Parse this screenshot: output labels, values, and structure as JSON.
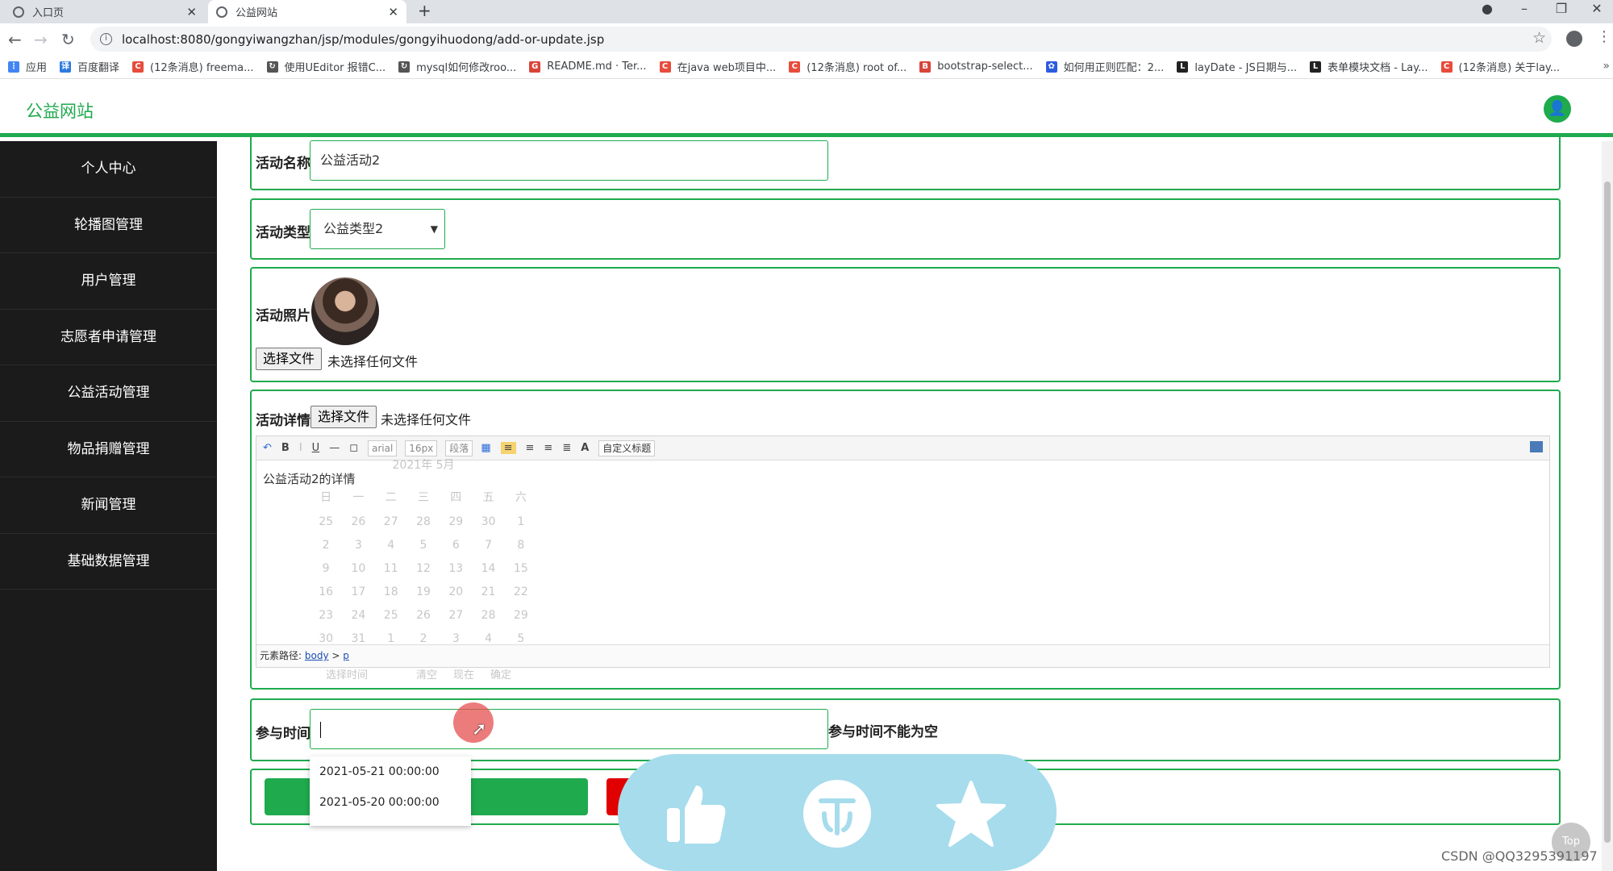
{
  "browser": {
    "tabs": [
      {
        "title": "入口页",
        "active": false
      },
      {
        "title": "公益网站",
        "active": true
      }
    ],
    "url": "localhost:8080/gongyiwangzhan/jsp/modules/gongyihuodong/add-or-update.jsp",
    "bookmarks": [
      {
        "label": "应用",
        "color": "#4285f4"
      },
      {
        "label": "百度翻译",
        "color": "#2d7ae0"
      },
      {
        "label": "(12条消息) freema...",
        "color": "#e74c3c"
      },
      {
        "label": "使用UEditor 报错C...",
        "color": "#555555"
      },
      {
        "label": "mysql如何修改roo...",
        "color": "#555555"
      },
      {
        "label": "README.md · Ter...",
        "color": "#d9443a"
      },
      {
        "label": "在java web项目中...",
        "color": "#e74c3c"
      },
      {
        "label": "(12条消息) root of...",
        "color": "#e74c3c"
      },
      {
        "label": "bootstrap-select...",
        "color": "#d9443a"
      },
      {
        "label": "如何用正则匹配：2...",
        "color": "#2d5be0"
      },
      {
        "label": "layDate - JS日期与...",
        "color": "#222222"
      },
      {
        "label": "表单模块文档 - Lay...",
        "color": "#222222"
      },
      {
        "label": "(12条消息) 关于lay...",
        "color": "#e74c3c"
      }
    ]
  },
  "header": {
    "title": "公益网站",
    "accent": "#1faa4e"
  },
  "sidebar": {
    "items": [
      {
        "label": "个人中心"
      },
      {
        "label": "轮播图管理"
      },
      {
        "label": "用户管理"
      },
      {
        "label": "志愿者申请管理"
      },
      {
        "label": "公益活动管理"
      },
      {
        "label": "物品捐赠管理"
      },
      {
        "label": "新闻管理"
      },
      {
        "label": "基础数据管理"
      }
    ]
  },
  "form": {
    "name_label": "活动名称",
    "name_value": "公益活动2",
    "type_label": "活动类型",
    "type_value": "公益类型2",
    "photo_label": "活动照片",
    "file_button": "选择文件",
    "no_file": "未选择任何文件",
    "detail_label": "活动详情",
    "time_label": "参与时间",
    "time_error": "参与时间不能为空"
  },
  "editor": {
    "font": "arial",
    "size": "16px",
    "paragraph": "段落",
    "custom_title": "自定义标题",
    "content": "公益活动2的详情",
    "path_label": "元素路径:",
    "path_body": "body",
    "path_sep": ">",
    "path_p": "p"
  },
  "calendar": {
    "header": "2021年  5月",
    "weekdays": [
      "日",
      "一",
      "二",
      "三",
      "四",
      "五",
      "六"
    ],
    "days": [
      "25",
      "26",
      "27",
      "28",
      "29",
      "30",
      "1",
      "2",
      "3",
      "4",
      "5",
      "6",
      "7",
      "8",
      "9",
      "10",
      "11",
      "12",
      "13",
      "14",
      "15",
      "16",
      "17",
      "18",
      "19",
      "20",
      "21",
      "22",
      "23",
      "24",
      "25",
      "26",
      "27",
      "28",
      "29",
      "30",
      "31",
      "1",
      "2",
      "3",
      "4",
      "5"
    ],
    "footer": [
      "选择时间",
      "清空",
      "现在",
      "确定"
    ]
  },
  "suggestions": [
    "2021-05-21 00:00:00",
    "2021-05-20 00:00:00"
  ],
  "overlay": {
    "top_button": "Top",
    "watermark": "CSDN @QQ3295391197"
  }
}
